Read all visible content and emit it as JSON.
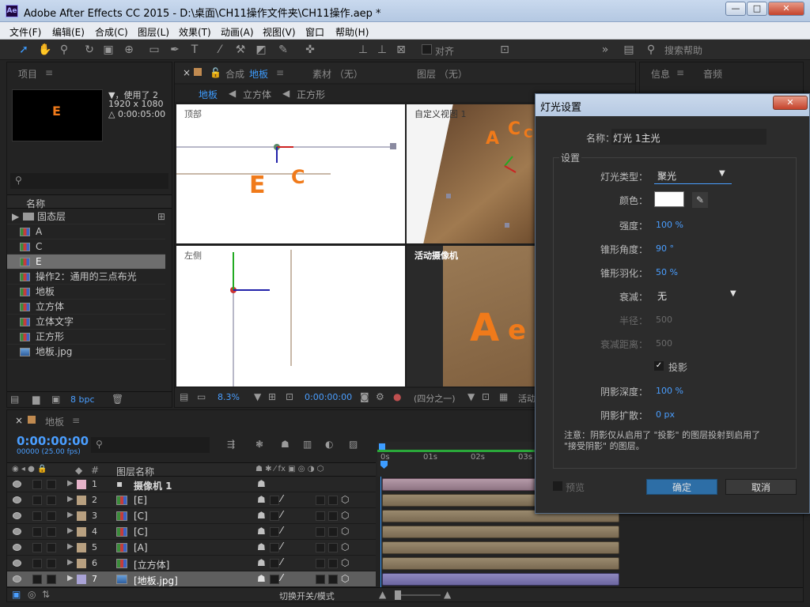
{
  "window": {
    "app_icon": "Ae",
    "title": "Adobe After Effects CC 2015 - D:\\桌面\\CH11操作文件夹\\CH11操作.aep *"
  },
  "menu": [
    "文件(F)",
    "编辑(E)",
    "合成(C)",
    "图层(L)",
    "效果(T)",
    "动画(A)",
    "视图(V)",
    "窗口",
    "帮助(H)"
  ],
  "toolbar": {
    "snap_label": "对齐",
    "search_placeholder": "搜索帮助"
  },
  "project": {
    "tab": "项目",
    "info_line1": "▼，使用了 2",
    "info_line2": "1920 x 1080",
    "info_line3": "△ 0:00:05:00",
    "thumb_letter": "E",
    "col_name": "名称",
    "items": [
      "固态层",
      "A",
      "C",
      "E",
      "操作2：通用的三点布光",
      "地板",
      "立方体",
      "立体文字",
      "正方形",
      "地板.jpg"
    ],
    "bpc": "8 bpc"
  },
  "comp": {
    "close": "×",
    "tab_prefix": "合成",
    "tab_name": "地板",
    "other_tabs": [
      "素材 （无）",
      "图层 （无）"
    ],
    "breadcrumb": [
      "地板",
      "立方体",
      "正方形"
    ],
    "view_top": "顶部",
    "view_custom": "自定义视图 1",
    "view_left": "左侧",
    "view_active": "活动摄像机",
    "zoom": "8.3%",
    "time": "0:00:00:00",
    "quality": "(四分之一)",
    "active_label": "活动"
  },
  "right_panel": {
    "tabs": [
      "信息",
      "音频"
    ]
  },
  "timeline": {
    "tab": "地板",
    "timecode": "0:00:00:00",
    "frames": "00000 (25.00 fps)",
    "col_num": "#",
    "col_name": "图层名称",
    "ruler": [
      "0s",
      "01s",
      "02s",
      "03s"
    ],
    "layers": [
      {
        "num": "1",
        "name": "摄像机 1",
        "color": "#e6b3c9",
        "type": "camera"
      },
      {
        "num": "2",
        "name": "[E]",
        "color": "#b8a080",
        "type": "comp"
      },
      {
        "num": "3",
        "name": "[C]",
        "color": "#b8a080",
        "type": "comp"
      },
      {
        "num": "4",
        "name": "[C]",
        "color": "#b8a080",
        "type": "comp"
      },
      {
        "num": "5",
        "name": "[A]",
        "color": "#b8a080",
        "type": "comp"
      },
      {
        "num": "6",
        "name": "[立方体]",
        "color": "#b8a080",
        "type": "comp"
      },
      {
        "num": "7",
        "name": "[地板.jpg]",
        "color": "#a9a3d6",
        "type": "image"
      }
    ],
    "footer_label": "切换开关/模式"
  },
  "dialog": {
    "title": "灯光设置",
    "name_label": "名称：",
    "name_value": "灯光 1主光",
    "group_label": "设置",
    "type_label": "灯光类型：",
    "type_value": "聚光",
    "color_label": "颜色：",
    "color_value": "#ffffff",
    "intensity_label": "强度：",
    "intensity_value": "100 %",
    "cone_angle_label": "锥形角度：",
    "cone_angle_value": "90 °",
    "cone_feather_label": "锥形羽化：",
    "cone_feather_value": "50 %",
    "falloff_label": "衰减：",
    "falloff_value": "无",
    "radius_label": "半径：",
    "radius_value": "500",
    "falloff_dist_label": "衰减距离：",
    "falloff_dist_value": "500",
    "shadow_label": "投影",
    "shadow_checked": "✓",
    "shadow_depth_label": "阴影深度：",
    "shadow_depth_value": "100 %",
    "shadow_spread_label": "阴影扩散：",
    "shadow_spread_value": "0 px",
    "note": "注意：阴影仅从启用了 \"投影\" 的图层投射到启用了 \"接受阴影\" 的图层。",
    "preview_label": "预览",
    "ok": "确定",
    "cancel": "取消"
  },
  "colors": {
    "accent": "#3d9cff",
    "ok_button": "#2d6ea6"
  }
}
